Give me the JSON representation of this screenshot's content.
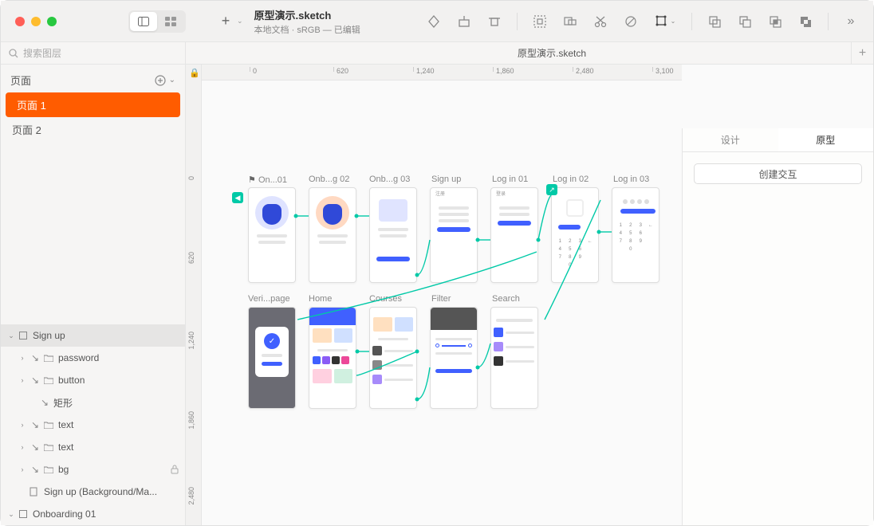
{
  "titlebar": {
    "doc_title": "原型演示.sketch",
    "doc_subtitle": "本地文档 · sRGB — 已编辑"
  },
  "tabrow": {
    "active_tab": "原型演示.sketch"
  },
  "left_panel": {
    "search_placeholder": "搜索图层",
    "pages_header": "页面",
    "pages": [
      {
        "label": "页面 1",
        "active": true
      },
      {
        "label": "页面 2",
        "active": false
      }
    ],
    "layers": [
      {
        "label": "Sign up",
        "type": "artboard",
        "expanded": true,
        "selected": true,
        "indent": 0
      },
      {
        "label": "password",
        "type": "group",
        "expanded": false,
        "indent": 1
      },
      {
        "label": "button",
        "type": "group",
        "expanded": false,
        "indent": 1
      },
      {
        "label": "矩形",
        "type": "shape",
        "indent": 2
      },
      {
        "label": "text",
        "type": "group",
        "expanded": false,
        "indent": 1
      },
      {
        "label": "text",
        "type": "group",
        "expanded": false,
        "indent": 1
      },
      {
        "label": "bg",
        "type": "group",
        "expanded": false,
        "locked": true,
        "indent": 1
      },
      {
        "label": "Sign up (Background/Ma...",
        "type": "slice",
        "indent": 1
      },
      {
        "label": "Onboarding 01",
        "type": "artboard",
        "expanded": false,
        "indent": 0
      }
    ]
  },
  "rulers": {
    "h": [
      "0",
      "620",
      "1,240",
      "1,860",
      "2,480",
      "3,100"
    ],
    "v": [
      "0",
      "620",
      "1,240",
      "1,860",
      "2,480"
    ]
  },
  "artboards_row1": [
    {
      "label": "On...01"
    },
    {
      "label": "Onb...g 02"
    },
    {
      "label": "Onb...g 03"
    },
    {
      "label": "Sign up"
    },
    {
      "label": "Log in 01"
    },
    {
      "label": "Log in 02"
    },
    {
      "label": "Log in 03"
    }
  ],
  "artboards_row2": [
    {
      "label": "Veri...page"
    },
    {
      "label": "Home"
    },
    {
      "label": "Courses"
    },
    {
      "label": "Filter"
    },
    {
      "label": "Search"
    }
  ],
  "right_panel": {
    "tab_design": "设计",
    "tab_prototype": "原型",
    "create_button": "创建交互"
  },
  "artboard_text": {
    "signup": "注册",
    "login": "登录"
  }
}
